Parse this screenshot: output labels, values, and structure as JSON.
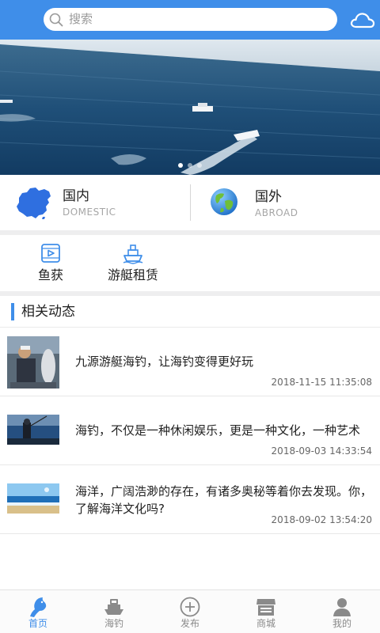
{
  "header": {
    "search_placeholder": "搜索",
    "icons": {
      "search": "search-icon",
      "cloud": "cloud-icon"
    }
  },
  "banner": {
    "image": "ocean-boats-photo",
    "dots": 3,
    "active_dot": 1
  },
  "regions": [
    {
      "title": "国内",
      "subtitle": "DOMESTIC",
      "icon": "china-map-icon"
    },
    {
      "title": "国外",
      "subtitle": "ABROAD",
      "icon": "globe-icon"
    }
  ],
  "services": [
    {
      "label": "鱼获",
      "icon": "video-icon"
    },
    {
      "label": "游艇租赁",
      "icon": "ship-icon"
    }
  ],
  "section": {
    "title": "相关动态"
  },
  "news": [
    {
      "title": "九源游艇海钓，让海钓变得更好玩",
      "time": "2018-11-15 11:35:08",
      "thumb": "fisherman-holding-fish-photo"
    },
    {
      "title": "海钓，不仅是一种休闲娱乐，更是一种文化，一种艺术",
      "time": "2018-09-03 14:33:54",
      "thumb": "sea-fishing-photo"
    },
    {
      "title": "海洋，广阔浩渺的存在，有诸多奥秘等着你去发现。你，了解海洋文化吗?",
      "time": "2018-09-02 13:54:20",
      "thumb": "ocean-beach-photo"
    }
  ],
  "tabs": [
    {
      "label": "首页",
      "icon": "fish-icon",
      "active": true
    },
    {
      "label": "海钓",
      "icon": "boat-icon",
      "active": false
    },
    {
      "label": "发布",
      "icon": "plus-circle-icon",
      "active": false
    },
    {
      "label": "商城",
      "icon": "store-icon",
      "active": false
    },
    {
      "label": "我的",
      "icon": "user-icon",
      "active": false
    }
  ],
  "colors": {
    "accent": "#3f8ee9",
    "text": "#222222",
    "muted": "#a6a6a6",
    "inactive_tab": "#8a8a8a"
  }
}
